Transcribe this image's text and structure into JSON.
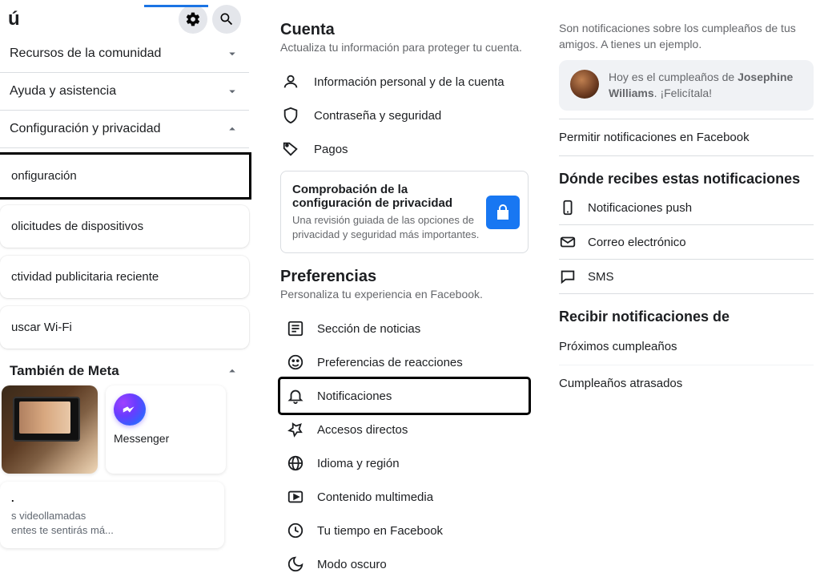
{
  "left": {
    "title_fragment": "ú",
    "items": [
      {
        "label": "Recursos de la comunidad",
        "expandable": true,
        "expanded": false
      },
      {
        "label": "Ayuda y asistencia",
        "expandable": true,
        "expanded": false
      },
      {
        "label": "Configuración y privacidad",
        "expandable": true,
        "expanded": true
      }
    ],
    "sub_cards": [
      {
        "label": "onfiguración",
        "highlighted": true
      },
      {
        "label": "olicitudes de dispositivos"
      },
      {
        "label": "ctividad publicitaria reciente"
      },
      {
        "label": "uscar Wi-Fi"
      }
    ],
    "meta_section_title": "También de Meta",
    "messenger_label": "Messenger",
    "trunc_text": "s videollamadas\nentes te sentirás má..."
  },
  "center": {
    "account": {
      "heading": "Cuenta",
      "sub": "Actualiza tu información para proteger tu cuenta.",
      "items": [
        {
          "icon": "user",
          "label": "Información personal y de la cuenta"
        },
        {
          "icon": "shield",
          "label": "Contraseña y seguridad"
        },
        {
          "icon": "tag",
          "label": "Pagos"
        }
      ],
      "privacy": {
        "title": "Comprobación de la configuración de privacidad",
        "sub": "Una revisión guiada de las opciones de privacidad y seguridad más importantes."
      }
    },
    "prefs": {
      "heading": "Preferencias",
      "sub": "Personaliza tu experiencia en Facebook.",
      "items": [
        {
          "icon": "feed",
          "label": "Sección de noticias"
        },
        {
          "icon": "react",
          "label": "Preferencias de reacciones"
        },
        {
          "icon": "bell",
          "label": "Notificaciones",
          "highlighted": true
        },
        {
          "icon": "pin",
          "label": "Accesos directos"
        },
        {
          "icon": "globe",
          "label": "Idioma y región"
        },
        {
          "icon": "media",
          "label": "Contenido multimedia"
        },
        {
          "icon": "clock",
          "label": "Tu tiempo en Facebook"
        },
        {
          "icon": "moon",
          "label": "Modo oscuro"
        }
      ]
    }
  },
  "right": {
    "desc": "Son notificaciones sobre los cumpleaños de tus amigos. A  tienes un ejemplo.",
    "example_prefix": "Hoy es el cumpleaños de ",
    "example_name": "Josephine Williams",
    "example_suffix": ". ¡Felicítala!",
    "permit": "Permitir notificaciones en Facebook",
    "where_heading": "Dónde recibes estas notificaciones",
    "channels": [
      {
        "icon": "push",
        "label": "Notificaciones push"
      },
      {
        "icon": "mail",
        "label": "Correo electrónico"
      },
      {
        "icon": "sms",
        "label": "SMS"
      }
    ],
    "receive_heading": "Recibir notificaciones de",
    "receive_items": [
      "Próximos cumpleaños",
      "Cumpleaños atrasados"
    ]
  }
}
